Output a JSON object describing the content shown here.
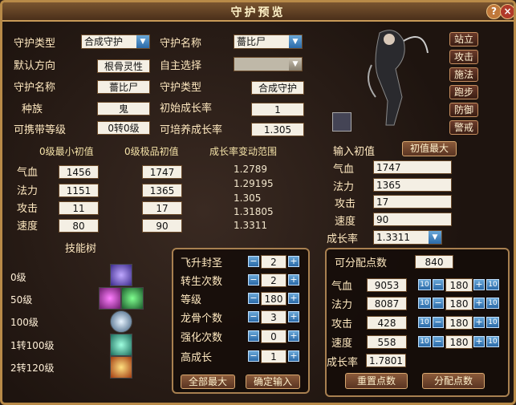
{
  "title": "守护预览",
  "window_buttons": {
    "help": "?",
    "close": "×"
  },
  "top": {
    "type_label": "守护类型",
    "type_select": "合成守护",
    "name_label": "守护名称",
    "name_select": "薔比尸",
    "default_dir_label": "默认方向",
    "default_dir_value": "根骨灵性",
    "auto_select_label": "自主选择",
    "auto_select_value": "",
    "name2_label": "守护名称",
    "name2_value": "薔比尸",
    "type2_label": "守护类型",
    "type2_value": "合成守护",
    "race_label": "种族",
    "race_value": "鬼",
    "init_growth_label": "初始成长率",
    "init_growth_value": "1",
    "carry_level_label": "可携带等级",
    "carry_level_value": "0转0级",
    "cult_growth_label": "可培养成长率",
    "cult_growth_value": "1.305"
  },
  "actions": [
    "站立",
    "攻击",
    "施法",
    "跑步",
    "防御",
    "警戒"
  ],
  "stats_header": {
    "min": "0级最小初值",
    "max": "0级极品初值",
    "range": "成长率变动范围"
  },
  "stats": [
    {
      "label": "气血",
      "min": "1456",
      "max": "1747",
      "range": "1.2789"
    },
    {
      "label": "法力",
      "min": "1151",
      "max": "1365",
      "range": "1.29195"
    },
    {
      "label": "攻击",
      "min": "11",
      "max": "17",
      "range": "1.305"
    },
    {
      "label": "速度",
      "min": "80",
      "max": "90",
      "range": "1.31805"
    }
  ],
  "extra_range": "1.3311",
  "input_init": {
    "label": "输入初值",
    "max_button": "初值最大",
    "fields": [
      {
        "label": "气血",
        "value": "1747"
      },
      {
        "label": "法力",
        "value": "1365"
      },
      {
        "label": "攻击",
        "value": "17"
      },
      {
        "label": "速度",
        "value": "90"
      }
    ],
    "growth_label": "成长率",
    "growth_value": "1.3311"
  },
  "skill_tree": {
    "label": "技能树",
    "levels": [
      "0级",
      "50级",
      "100级",
      "1转100级",
      "2转120级"
    ]
  },
  "mid_panel": {
    "rows": [
      {
        "label": "飞升封圣",
        "value": "2"
      },
      {
        "label": "转生次数",
        "value": "2"
      },
      {
        "label": "等级",
        "value": "180"
      },
      {
        "label": "龙骨个数",
        "value": "3"
      },
      {
        "label": "强化次数",
        "value": "0"
      },
      {
        "label": "高成长",
        "value": "1"
      }
    ],
    "btn_all_max": "全部最大",
    "btn_confirm": "确定输入"
  },
  "points_panel": {
    "label": "可分配点数",
    "value": "840",
    "rows": [
      {
        "label": "气血",
        "value": "9053",
        "alloc": "180"
      },
      {
        "label": "法力",
        "value": "8087",
        "alloc": "180"
      },
      {
        "label": "攻击",
        "value": "428",
        "alloc": "180"
      },
      {
        "label": "速度",
        "value": "558",
        "alloc": "180"
      }
    ],
    "growth_label": "成长率",
    "growth_value": "1.7801",
    "btn_reset": "重置点数",
    "btn_assign": "分配点数",
    "ten": "10"
  },
  "colors": {
    "frame": "#b88a48",
    "accent": "#6aa8d8"
  }
}
